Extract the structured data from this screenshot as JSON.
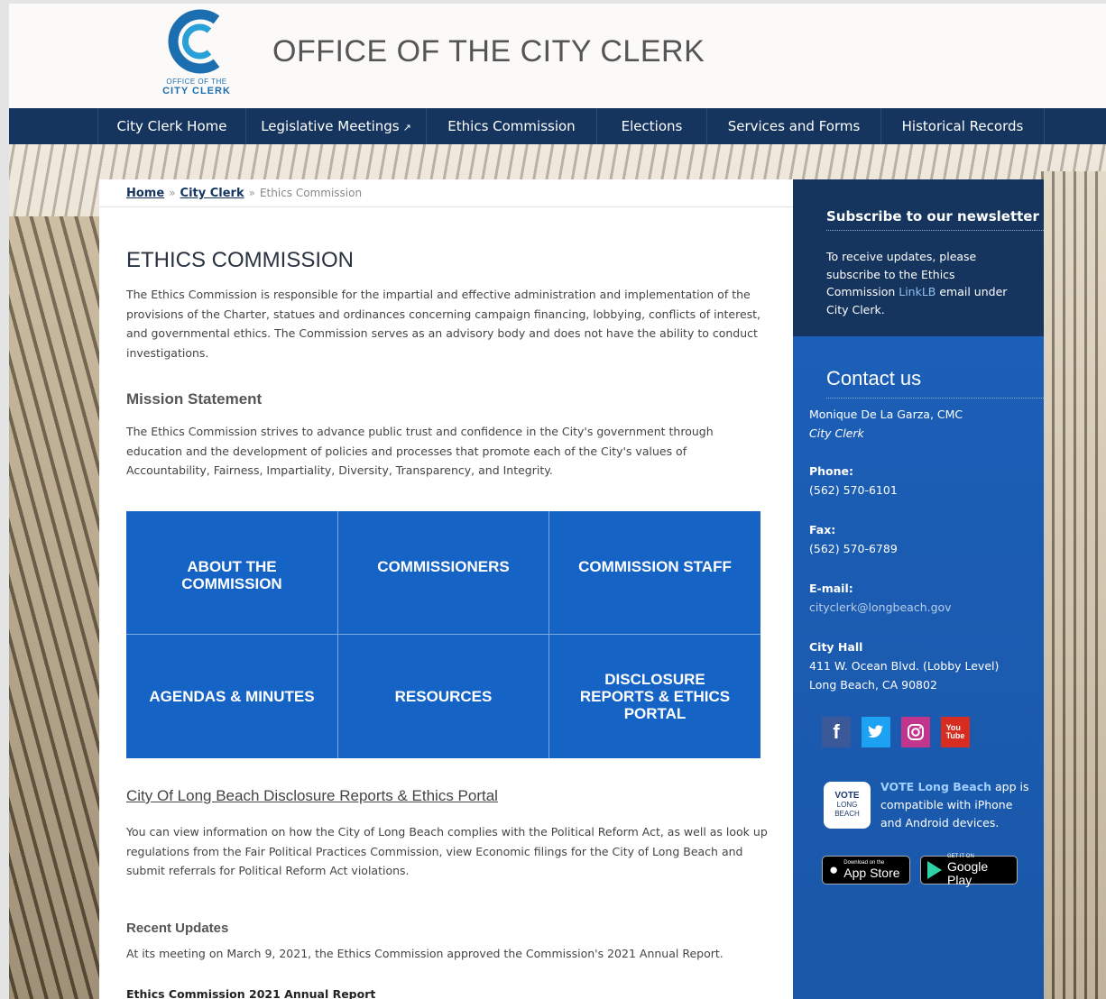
{
  "header": {
    "logo": {
      "line1": "OFFICE OF THE",
      "line2": "CITY CLERK",
      "icon": "cc-logo-icon",
      "color": "#1b6fb0"
    },
    "title": "OFFICE OF THE CITY CLERK"
  },
  "nav": {
    "items": [
      {
        "label": "City Clerk Home"
      },
      {
        "label": "Legislative Meetings",
        "external_icon": "↗"
      },
      {
        "label": "Ethics Commission"
      },
      {
        "label": "Elections"
      },
      {
        "label": "Services and Forms"
      },
      {
        "label": "Historical Records"
      }
    ]
  },
  "breadcrumb": {
    "home": "Home",
    "sep1": "»",
    "city_clerk": "City Clerk",
    "sep2": "»",
    "current": "Ethics Commission"
  },
  "main": {
    "title": "ETHICS COMMISSION",
    "intro": "The Ethics Commission is responsible for the impartial and effective administration and implementation of the provisions of the Charter, statues and ordinances concerning campaign financing, lobbying, conflicts of interest, and governmental ethics. The Commission serves as an advisory body and does not have the ability to conduct investigations.",
    "mission_heading": "Mission Statement",
    "mission_text": "The Ethics Commission strives to advance public trust and confidence in the City's government through education and the development of policies and processes that promote each of the City's values of Accountability, Fairness, Impartiality, Diversity, Transparency, and Integrity.",
    "tiles": [
      "ABOUT THE COMMISSION",
      "COMMISSIONERS",
      "COMMISSION STAFF",
      "AGENDAS & MINUTES",
      "RESOURCES",
      "DISCLOSURE REPORTS & ETHICS PORTAL"
    ],
    "portal_link": "City Of Long Beach Disclosure Reports & Ethics Portal",
    "portal_text": "You can view information on how the City of Long Beach complies with the Political Reform Act, as well as look up regulations from the Fair Political Practices Commission, view Economic filings for the City of Long Beach and submit referrals for Political Reform Act violations.",
    "updates_heading": "Recent Updates",
    "updates_text": "At its meeting on March 9, 2021, the Ethics Commission approved the Commission's 2021 Annual Report.",
    "report_title": "Ethics Commission 2021 Annual Report",
    "tile_color": "#1563c4"
  },
  "sidebar": {
    "subscribe": {
      "title": "Subscribe to our newsletter",
      "text_before": "To receive updates, please subscribe to the Ethics Commission ",
      "link": "LinkLB",
      "text_after": " email under City Clerk."
    },
    "contact": {
      "title": "Contact us",
      "name": "Monique De La Garza, CMC",
      "role": "City Clerk",
      "phone_label": "Phone:",
      "phone": "(562) 570-6101",
      "fax_label": "Fax:",
      "fax": "(562) 570-6789",
      "email_label": "E-mail:",
      "email": "cityclerk@longbeach.gov",
      "hall_label": "City Hall",
      "address1": "411 W. Ocean Blvd. (Lobby Level)",
      "address2": "Long Beach, CA 90802"
    },
    "socials": [
      "facebook-icon",
      "twitter-icon",
      "instagram-icon",
      "youtube-icon"
    ],
    "vote": {
      "logo_line1": "VOTE",
      "logo_line2": "LONG",
      "logo_line3": "BEACH",
      "app_name": "VOTE Long Beach",
      "app_text": " app is compatible with iPhone and Android devices."
    },
    "app_store": {
      "small": "Download on the",
      "large": "App Store"
    },
    "google_play": {
      "small": "GET IT ON",
      "large": "Google Play"
    },
    "color_dark": "#16355e",
    "color_blue": "#1a5eb8"
  }
}
